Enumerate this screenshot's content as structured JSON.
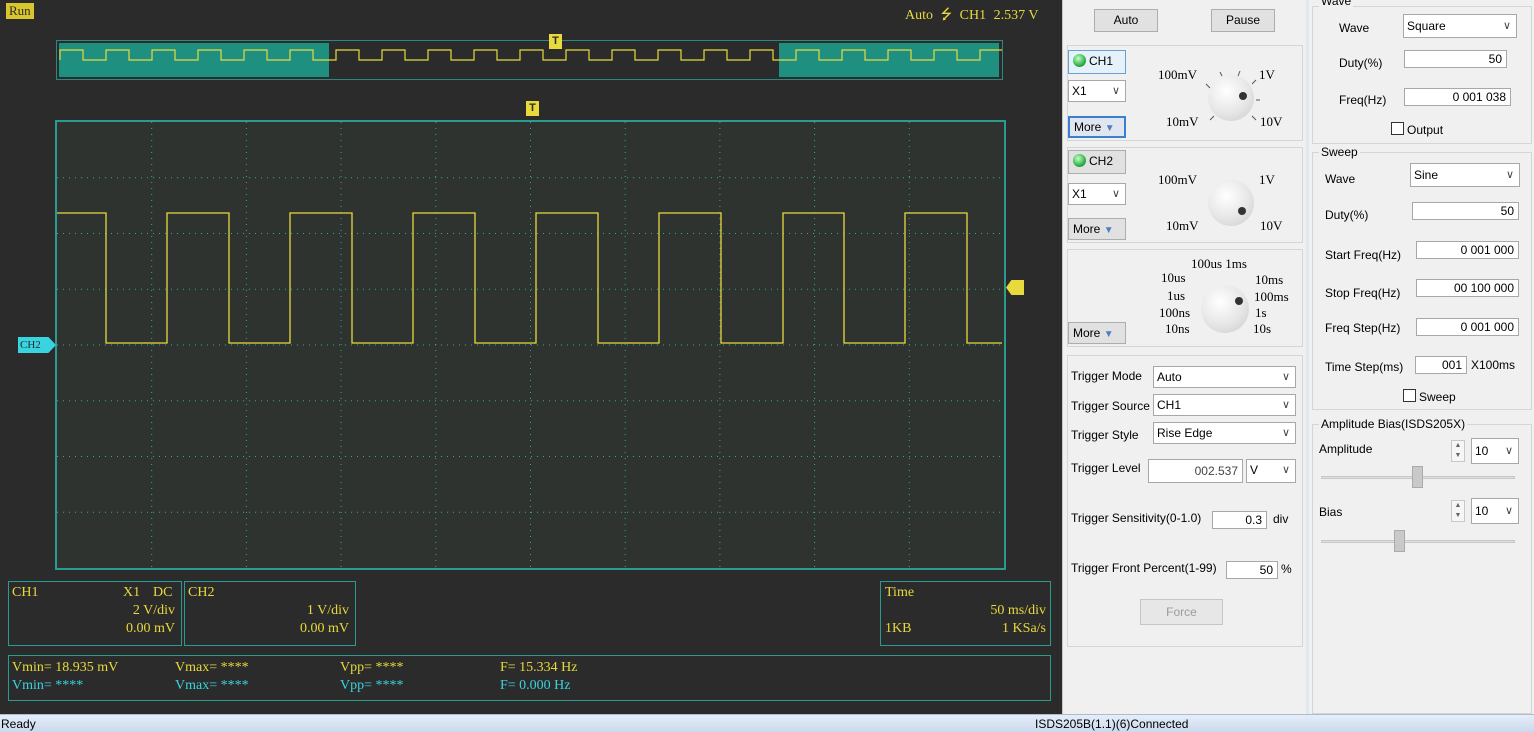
{
  "scope": {
    "run_label": "Run",
    "trigger_mode": "Auto",
    "trigger_channel": "CH1",
    "trigger_level": "2.537 V",
    "trigger_marker": "T",
    "ch2_marker": "CH2",
    "ch1": {
      "name": "CH1",
      "probe": "X1",
      "coupling": "DC",
      "scale": "2 V/div",
      "offset": "0.00 mV"
    },
    "ch2": {
      "name": "CH2",
      "scale": "1 V/div",
      "offset": "0.00 mV"
    },
    "time": {
      "title": "Time",
      "scale": "50 ms/div",
      "memory": "1KB",
      "rate": "1 KSa/s"
    },
    "measure_ch1": {
      "vmin": "Vmin= 18.935 mV",
      "vmax": "Vmax= ****",
      "vpp": "Vpp= ****",
      "freq": "F= 15.334 Hz"
    },
    "measure_ch2": {
      "vmin": "Vmin= ****",
      "vmax": "Vmax= ****",
      "vpp": "Vpp= ****",
      "freq": "F= 0.000 Hz"
    },
    "colors": {
      "trace": "#e8d93c",
      "grid": "#2b9b90",
      "ch2": "#39d4e0",
      "plot_bg": "#2e332f"
    }
  },
  "controls": {
    "auto_button": "Auto",
    "pause_button": "Pause",
    "ch1_button": "CH1",
    "ch2_button": "CH2",
    "ch1_probe": "X1",
    "ch2_probe": "X1",
    "more_label": "More",
    "volt_knob": {
      "tl": "100mV",
      "tr": "1V",
      "bl": "10mV",
      "br": "10V"
    },
    "time_knob": {
      "top": "100us  1ms",
      "l1": "10us",
      "l2": "1us",
      "l3": "100ns",
      "l4": "10ns",
      "r1": "10ms",
      "r2": "100ms",
      "r3": "1s",
      "r4": "10s"
    },
    "trigger_mode_label": "Trigger Mode",
    "trigger_mode_value": "Auto",
    "trigger_source_label": "Trigger Source",
    "trigger_source_value": "CH1",
    "trigger_style_label": "Trigger Style",
    "trigger_style_value": "Rise Edge",
    "trigger_level_label": "Trigger Level",
    "trigger_level_value": "002.537",
    "trigger_level_unit": "V",
    "sensitivity_label": "Trigger Sensitivity(0-1.0)",
    "sensitivity_value": "0.3",
    "sensitivity_unit": "div",
    "front_label": "Trigger Front Percent(1-99)",
    "front_value": "50",
    "front_unit": "%",
    "force_button": "Force"
  },
  "generator": {
    "wave_group": "Wave",
    "wave_label": "Wave",
    "wave_value": "Square",
    "duty_label": "Duty(%)",
    "duty_value": "50",
    "freq_label": "Freq(Hz)",
    "freq_value": "0 001 038",
    "output_label": "Output",
    "sweep_group": "Sweep",
    "sweep_wave_label": "Wave",
    "sweep_wave_value": "Sine",
    "sweep_duty_label": "Duty(%)",
    "sweep_duty_value": "50",
    "start_label": "Start Freq(Hz)",
    "start_value": "0 001 000",
    "stop_label": "Stop Freq(Hz)",
    "stop_value": "00 100 000",
    "step_label": "Freq Step(Hz)",
    "step_value": "0 001 000",
    "time_step_label": "Time Step(ms)",
    "time_step_value": "001",
    "time_step_unit": "X100ms",
    "sweep_check_label": "Sweep",
    "amp_group": "Amplitude Bias(ISDS205X)",
    "amp_label": "Amplitude",
    "amp_value": "10",
    "bias_label": "Bias",
    "bias_value": "10"
  },
  "status": {
    "left": "Ready",
    "right": "ISDS205B(1.1)(6)Connected"
  }
}
